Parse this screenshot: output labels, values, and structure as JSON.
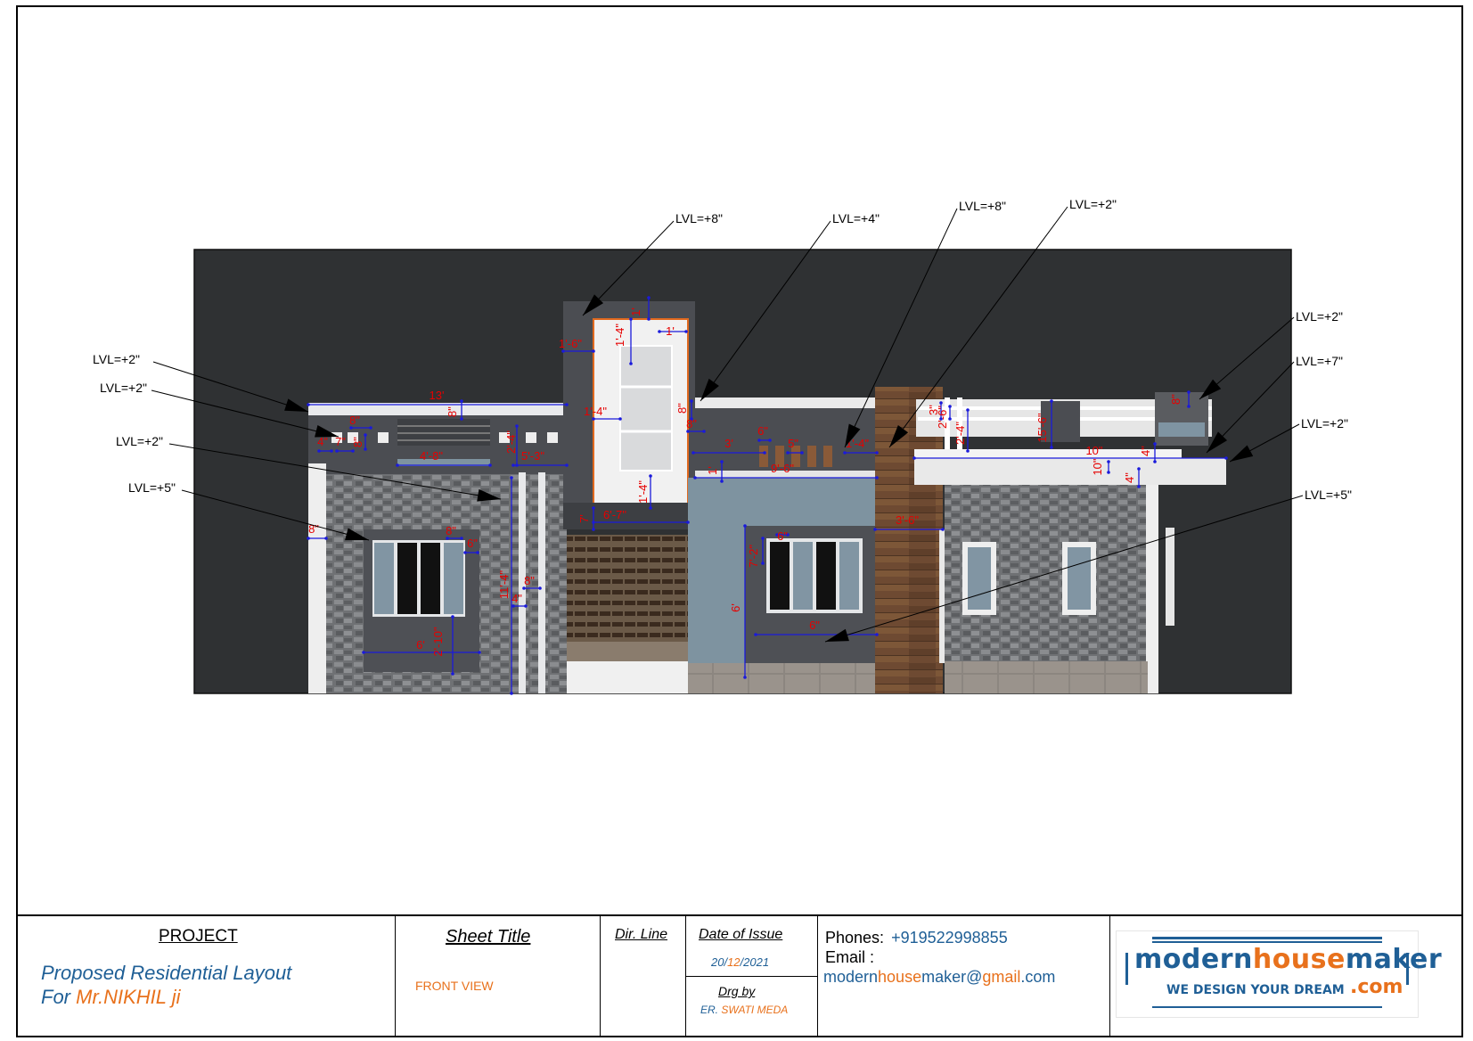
{
  "drawing": {
    "level_labels": [
      "LVL=+8\"",
      "LVL=+4\"",
      "LVL=+8\"",
      "LVL=+2\"",
      "LVL=+2\"",
      "LVL=+7\"",
      "LVL=+2\"",
      "LVL=+5\"",
      "LVL=+2\"",
      "LVL=+2\"",
      "LVL=+2\"",
      "LVL=+5\""
    ],
    "dimensions": [
      "1'",
      "1'-4\"",
      "1'",
      "1'-6\"",
      "1'-4\"",
      "13'",
      "8\"",
      "8\"",
      "4\"",
      "7\"",
      "8\"",
      "4'-8\"",
      "2'-4\"",
      "5'-3\"",
      "1'-4\"",
      "6'-7\"",
      "7'",
      "8\"",
      "11'-4\"",
      "8\"",
      "4\"",
      "8\"",
      "6\"",
      "6'",
      "2'-10\"",
      "8\"",
      "8\"",
      "3'",
      "6\"",
      "5\"",
      "1'-4\"",
      "1'",
      "9'-6\"",
      "3'-6\"",
      "6\"",
      "7'-2\"",
      "6'",
      "6\"",
      "3\"",
      "2'-6\"",
      "2'-4\"",
      "15'-6\"",
      "10\"",
      "4\"",
      "10\"",
      "4\"",
      "8\""
    ],
    "colors": {
      "dimension": "#e60000",
      "dim_line": "#1a1adb",
      "background": "#2f3133",
      "stone": "#6d6f72"
    }
  },
  "title_block": {
    "project_label": "PROJECT",
    "project_line1": "Proposed Residential Layout",
    "project_line2_prefix": "For ",
    "project_client": "Mr.NIKHIL  ji",
    "sheet_title_label": "Sheet Title",
    "sheet_title_value": "FRONT VIEW",
    "dir_line_label": "Dir. Line",
    "date_label": "Date of Issue",
    "date_day": "20/",
    "date_month": "12",
    "date_year": "/2021",
    "drg_by_label": "Drg by",
    "drg_prefix": "ER. ",
    "drg_name": "SWATI MEDA",
    "phones_label": "Phones:",
    "phones_value": "+919522998855",
    "email_label": "Email :",
    "email_p1": "modern",
    "email_p2": "house",
    "email_p3": "maker@",
    "email_p4": "gmail",
    "email_p5": ".com"
  },
  "logo": {
    "word_a": "modern",
    "word_b": "house",
    "word_c": "maker",
    "tagline": "WE DESIGN YOUR DREAM",
    "domain": ".com"
  }
}
